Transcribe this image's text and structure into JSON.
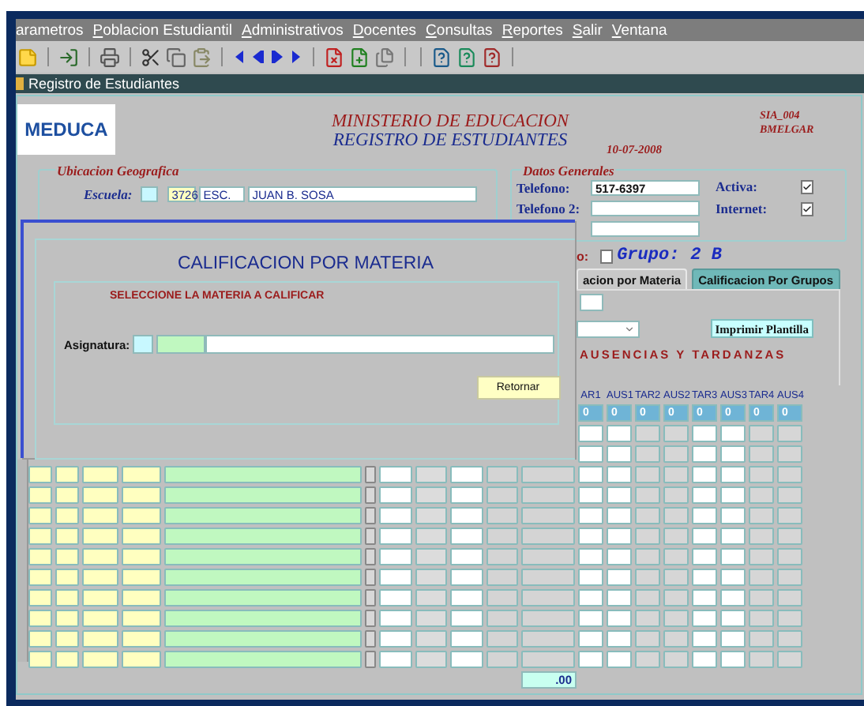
{
  "menu": [
    {
      "label": "arametros",
      "mnemonic": false
    },
    {
      "label": "Poblacion Estudiantil",
      "mnemonic": true
    },
    {
      "label": "Administrativos",
      "mnemonic": true
    },
    {
      "label": "Docentes",
      "mnemonic": true
    },
    {
      "label": "Consultas",
      "mnemonic": true
    },
    {
      "label": "Reportes",
      "mnemonic": true
    },
    {
      "label": "Salir",
      "mnemonic": true
    },
    {
      "label": "Ventana",
      "mnemonic": true
    }
  ],
  "window": {
    "title": "Registro de Estudiantes"
  },
  "header": {
    "logo": "MEDUCA",
    "ministry": "MINISTERIO DE EDUCACION",
    "register": "REGISTRO DE ESTUDIANTES",
    "date": "10-07-2008",
    "code": "SIA_004",
    "user": "BMELGAR"
  },
  "location": {
    "legend": "Ubicacion Geografica",
    "school_label": "Escuela:",
    "school_code": "3726",
    "school_type": "ESC.",
    "school_name": "JUAN B. SOSA"
  },
  "general": {
    "legend": "Datos Generales",
    "phone_label": "Telefono:",
    "phone": "517-6397",
    "phone2_label": "Telefono 2:",
    "active_label": "Activa:",
    "active": true,
    "internet_label": "Internet:",
    "internet": true
  },
  "group": {
    "label_fragment": "o:",
    "checked": false,
    "label": "Grupo:",
    "value": "2 B"
  },
  "tabs": [
    {
      "label": "acion por Materia",
      "selected": true
    },
    {
      "label": "Calificacion Por Grupos",
      "selected": false
    }
  ],
  "print_button": "Imprimir Plantilla",
  "absences": {
    "title": "AUSENCIAS Y TARDANZAS",
    "columns": [
      {
        "label": "AR1",
        "kind": "entry",
        "first": "0"
      },
      {
        "label": "AUS1",
        "kind": "entry",
        "first": "0"
      },
      {
        "label": "TAR2",
        "kind": "locked",
        "first": "0"
      },
      {
        "label": "AUS2",
        "kind": "locked",
        "first": "0"
      },
      {
        "label": "TAR3",
        "kind": "entry",
        "first": "0"
      },
      {
        "label": "AUS3",
        "kind": "entry",
        "first": "0"
      },
      {
        "label": "TAR4",
        "kind": "locked",
        "first": "0"
      },
      {
        "label": "AUS4",
        "kind": "locked",
        "first": "0"
      }
    ]
  },
  "total": ".00",
  "dialog": {
    "title": "CALIFICACION POR MATERIA",
    "prompt": "SELECCIONE LA MATERIA A CALIFICAR",
    "subject_label": "Asignatura:",
    "return_button": "Retornar"
  }
}
